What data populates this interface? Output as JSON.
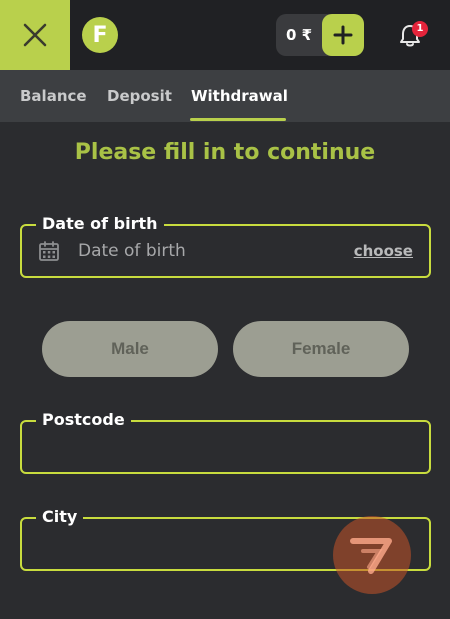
{
  "header": {
    "logo_letter": "F",
    "balance": "0 ₹",
    "notification_count": "1",
    "colors": {
      "accent": "#b9d04c",
      "badge": "#e4243b"
    },
    "icons": [
      "close-icon",
      "plus-icon",
      "bell-icon"
    ]
  },
  "tabs": [
    {
      "label": "Balance",
      "active": false
    },
    {
      "label": "Deposit",
      "active": false
    },
    {
      "label": "Withdrawal",
      "active": true
    }
  ],
  "form": {
    "heading": "Please fill in to continue",
    "dob": {
      "label": "Date of birth",
      "placeholder": "Date of birth",
      "action": "choose",
      "icon": "calendar-icon"
    },
    "gender": {
      "male": "Male",
      "female": "Female"
    },
    "postcode": {
      "label": "Postcode",
      "value": ""
    },
    "city": {
      "label": "City",
      "value": ""
    }
  }
}
